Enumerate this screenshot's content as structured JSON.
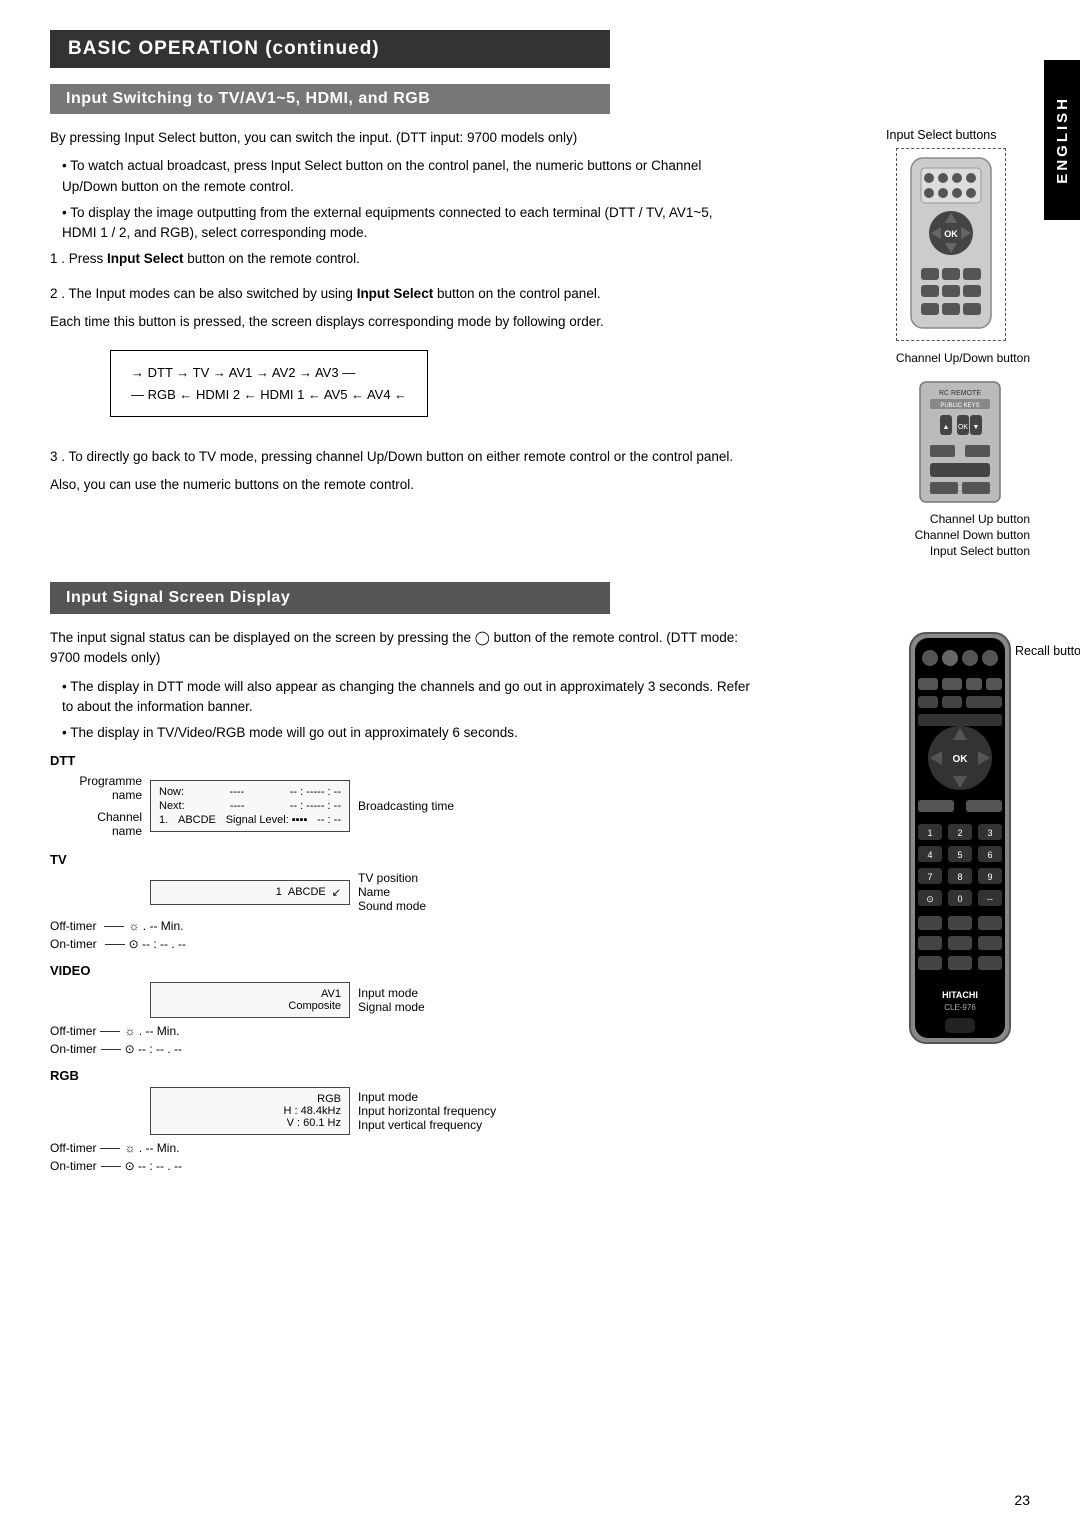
{
  "page": {
    "title": "BASIC OPERATION (continued)",
    "language_tab": "ENGLISH",
    "page_number": "23"
  },
  "section1": {
    "header": "Input Switching to TV/AV1~5, HDMI, and RGB",
    "intro": "By pressing Input Select button, you can switch the input. (DTT input: 9700 models only)",
    "input_select_buttons_label": "Input Select buttons",
    "bullets": [
      "To watch actual broadcast, press Input Select button on the control panel, the numeric buttons or Channel Up/Down button on the remote control.",
      "To display the image outputting from the external equipments connected to each terminal (DTT / TV, AV1~5, HDMI 1 / 2, and RGB), select corresponding mode."
    ],
    "step1": "1 . Press Input Select button on the remote control.",
    "step2_line1": "2 . The Input modes can be also switched by using Input Select button on the control panel.",
    "step2_line2": "Each time this button is pressed, the screen displays corresponding mode by following order.",
    "mode_cycle_row1": "→ DTT → TV → AV1 → AV2 → AV3 —",
    "mode_cycle_row2": "— RGB ← HDMI 2 ← HDMI 1 ← AV5 ← AV4 ←",
    "step3_line1": "3 . To directly go back to TV mode, pressing channel Up/Down button on either remote control or the control panel.",
    "step3_line2": "Also, you can use the numeric buttons on the remote control.",
    "channel_updown_label": "Channel Up/Down button",
    "channel_up_label": "Channel Up button",
    "channel_down_label": "Channel Down button",
    "input_select_btn_label": "Input Select button"
  },
  "section2": {
    "header": "Input Signal Screen Display",
    "intro": "The input signal status can be displayed on the screen by pressing the  button of the remote control. (DTT mode: 9700 models only)",
    "recall_button_label": "Recall button",
    "bullets": [
      "The display in DTT mode will also appear as changing the channels and go out in approximately 3 seconds. Refer to  about the information banner.",
      "The display in TV/Video/RGB mode will go out in approximately 6 seconds."
    ],
    "dtt": {
      "label": "DTT",
      "left_labels": [
        "Programme name",
        "Channel name"
      ],
      "right_labels": [
        "Broadcasting time"
      ],
      "screen": {
        "row1_left": "Now:",
        "row1_mid": "----",
        "row1_right": "-- : ----- : --",
        "row2_left": "Next:",
        "row2_mid": "----",
        "row2_right": "-- : ----- : --",
        "row3_left": "1.",
        "row3_mid": "ABCDE",
        "signal_level_label": "Signal Level:"
      }
    },
    "tv": {
      "label": "TV",
      "right_labels": [
        "TV position",
        "Name",
        "Sound mode"
      ],
      "left_labels": [
        "Off-timer",
        "On-timer"
      ],
      "screen": {
        "position": "1",
        "name": "ABCDE"
      }
    },
    "video": {
      "label": "VIDEO",
      "right_labels": [
        "Input mode",
        "Signal mode"
      ],
      "left_labels": [
        "Off-timer",
        "On-timer"
      ],
      "screen": {
        "line1": "AV1",
        "line2": "Composite"
      }
    },
    "rgb": {
      "label": "RGB",
      "right_labels": [
        "Input mode",
        "Input horizontal frequency",
        "Input vertical frequency"
      ],
      "left_labels": [
        "Off-timer",
        "On-timer"
      ],
      "screen": {
        "line1": "RGB",
        "line2": "H : 48.4kHz",
        "line3": "V : 60.1 Hz"
      }
    },
    "off_timer_value": "☼. -- Min.",
    "on_timer_value": "⊙ -- : -- . --"
  }
}
